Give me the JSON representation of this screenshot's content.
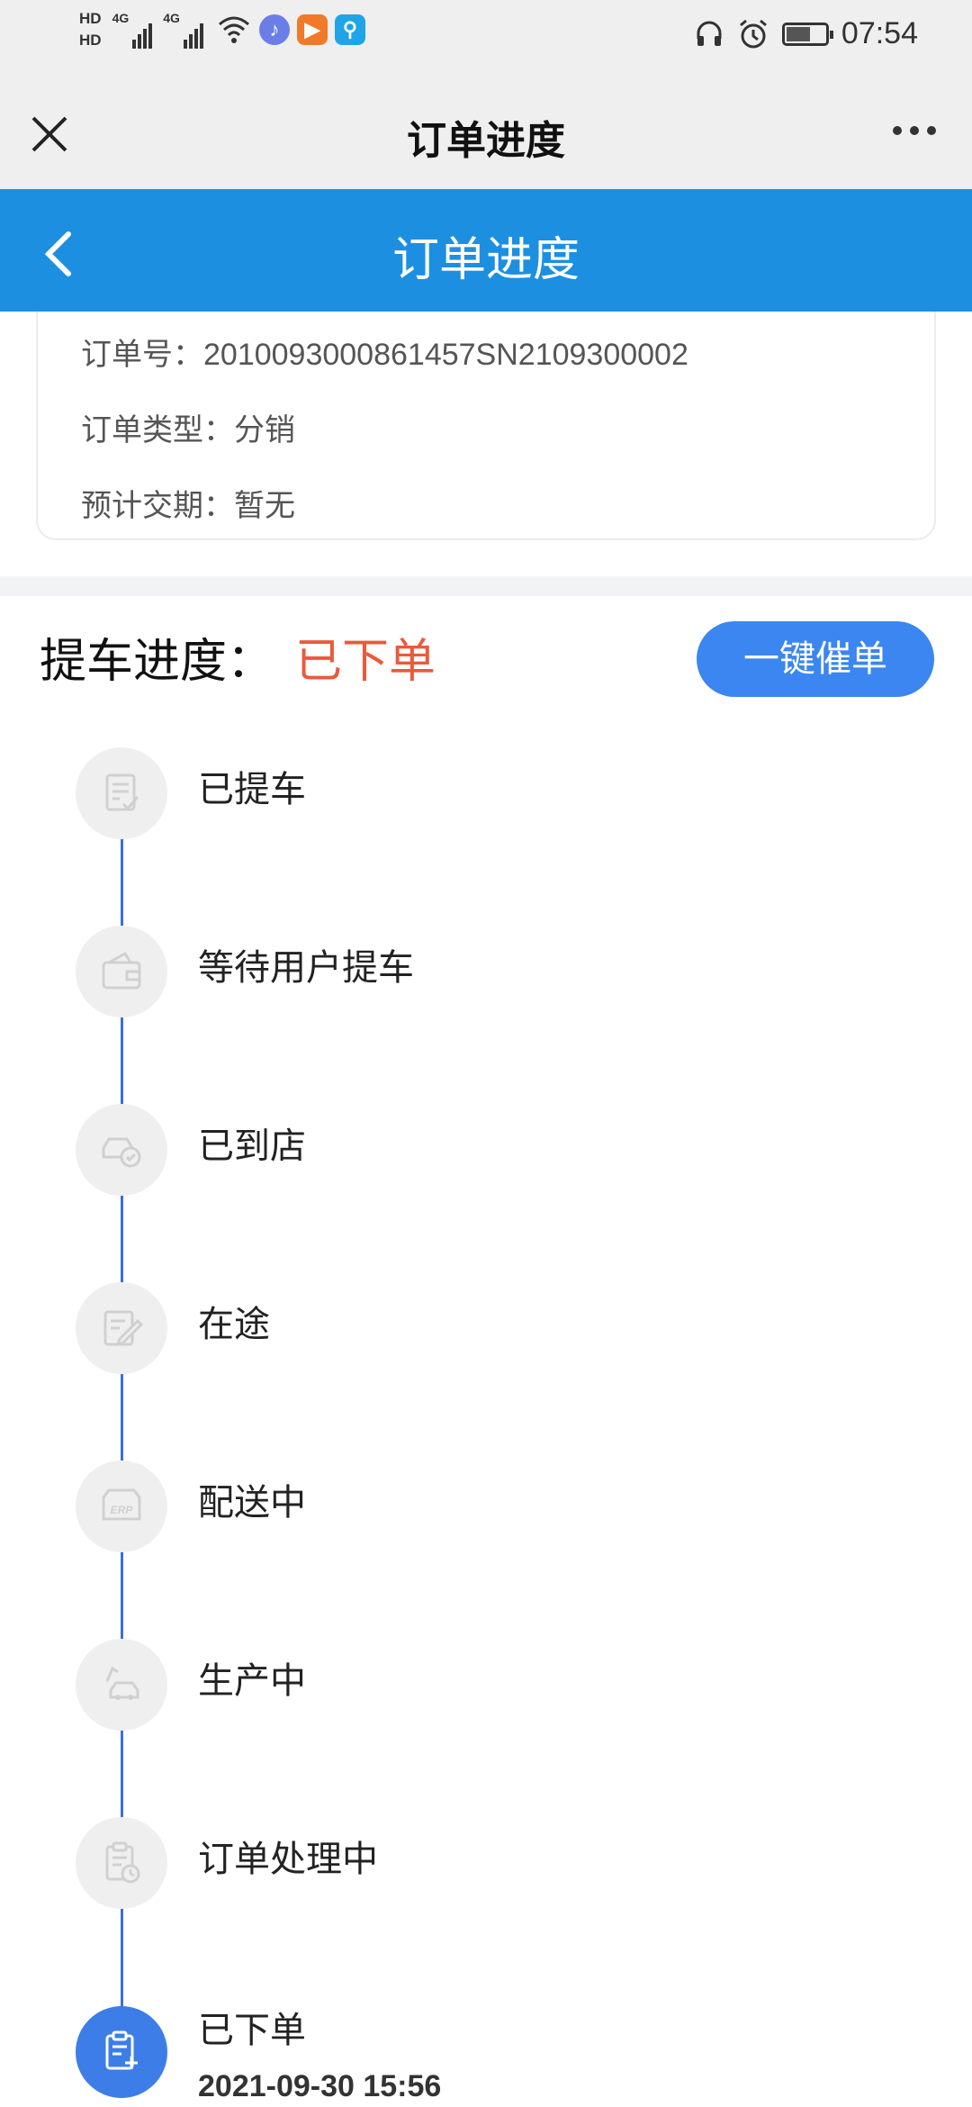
{
  "status_bar": {
    "hd1": "HD",
    "hd2": "HD",
    "net1": "4G",
    "net2": "4G",
    "time": "07:54",
    "battery_level": 0.6
  },
  "top_bar": {
    "title": "订单进度"
  },
  "header": {
    "title": "订单进度"
  },
  "order_info": {
    "order_no_label": "订单号：",
    "order_no": "2010093000861457SN2109300002",
    "type_label": "订单类型：",
    "type": "分销",
    "delivery_label": "预计交期：",
    "delivery": "暂无"
  },
  "progress": {
    "label": "提车进度：",
    "current_status": "已下单",
    "remind_button": "一键催单",
    "status_color": "#ea5a3c",
    "accent_color": "#3b86f0"
  },
  "steps": [
    {
      "label": "已提车",
      "icon": "checklist-icon",
      "active": false
    },
    {
      "label": "等待用户提车",
      "icon": "wallet-icon",
      "active": false
    },
    {
      "label": "已到店",
      "icon": "car-arrive-icon",
      "active": false
    },
    {
      "label": "在途",
      "icon": "edit-document-icon",
      "active": false
    },
    {
      "label": "配送中",
      "icon": "erp-truck-icon",
      "active": false
    },
    {
      "label": "生产中",
      "icon": "car-factory-icon",
      "active": false
    },
    {
      "label": "订单处理中",
      "icon": "clipboard-clock-icon",
      "active": false
    },
    {
      "label": "已下单",
      "icon": "clipboard-add-icon",
      "active": true,
      "time": "2021-09-30 15:56"
    }
  ]
}
